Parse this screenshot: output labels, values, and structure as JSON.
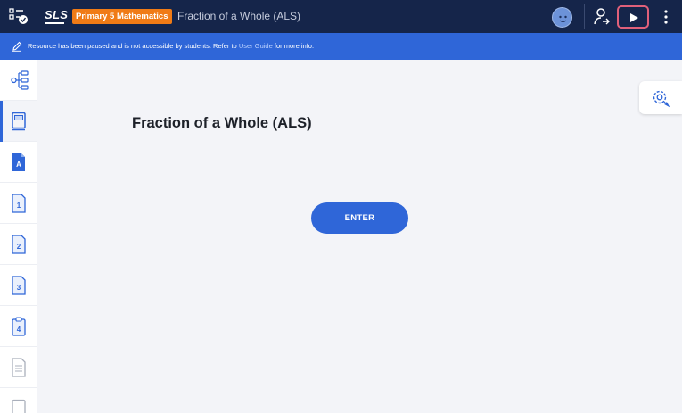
{
  "topbar": {
    "logo": "SLS",
    "subject_badge": "Primary 5 Mathematics",
    "title": "Fraction of a Whole (ALS)",
    "icons": [
      "menu-checklist-icon",
      "user-avatar",
      "share-user-icon",
      "play-icon",
      "more-vertical-icon"
    ]
  },
  "notice": {
    "text_before": "Resource has been paused and is not accessible by students. Refer to",
    "link": "User Guide",
    "text_after": "for more info."
  },
  "sidebar": {
    "items": [
      {
        "icon": "tree-structure-icon",
        "active": false
      },
      {
        "icon": "book-icon",
        "active": true
      },
      {
        "icon": "doc-a-icon",
        "label": "A",
        "active": false
      },
      {
        "icon": "doc-1-icon",
        "label": "1",
        "active": false
      },
      {
        "icon": "doc-2-icon",
        "label": "2",
        "active": false
      },
      {
        "icon": "doc-3-icon",
        "label": "3",
        "active": false
      },
      {
        "icon": "clipboard-4-icon",
        "label": "4",
        "active": false
      },
      {
        "icon": "doc-lines-icon",
        "active": false
      },
      {
        "icon": "doc-blank-icon",
        "active": false
      }
    ]
  },
  "main": {
    "heading": "Fraction of a Whole (ALS)",
    "enter_label": "ENTER"
  },
  "colors": {
    "topbar_bg": "#15254a",
    "accent_blue": "#2f66d8",
    "badge_orange": "#f07b16",
    "play_outline": "#e0607a"
  }
}
